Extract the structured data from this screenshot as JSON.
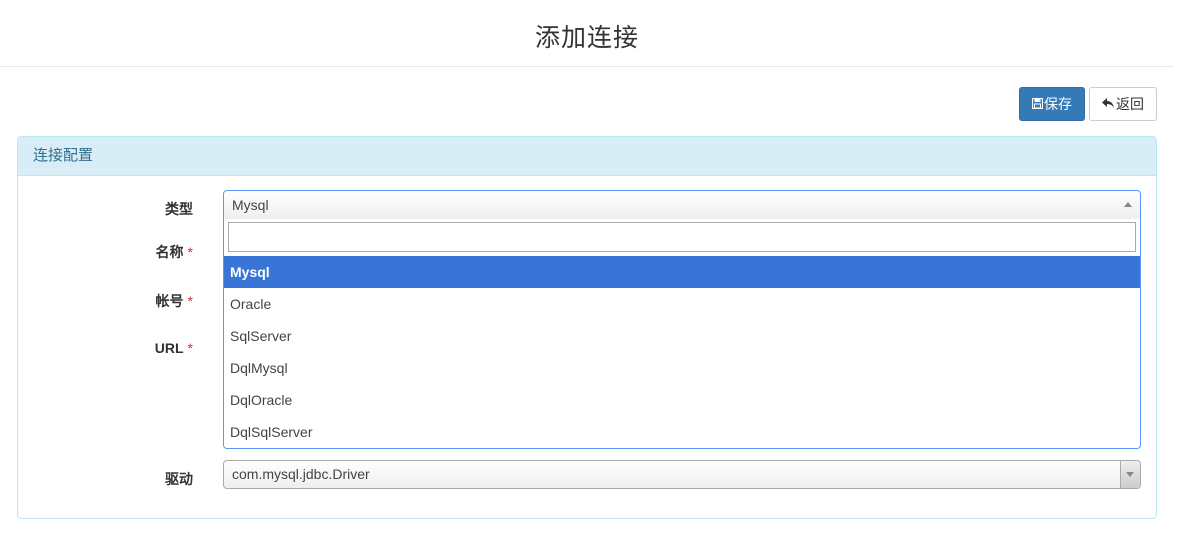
{
  "page": {
    "title": "添加连接"
  },
  "toolbar": {
    "save_label": "保存",
    "save_icon": "floppy-disk-icon",
    "back_label": "返回",
    "back_icon": "undo-arrow-icon",
    "save_color": "#337ab7"
  },
  "panel": {
    "heading": "连接配置",
    "heading_bg": "#d9edf7",
    "heading_color": "#31708f"
  },
  "form": {
    "type_label": "类型",
    "name_label": "名称",
    "account_label": "帐号",
    "url_label": "URL",
    "driver_label": "驱动",
    "required_mark": "*",
    "type_value": "Mysql",
    "type_search_value": "",
    "type_options": [
      "Mysql",
      "Oracle",
      "SqlServer",
      "DqlMysql",
      "DqlOracle",
      "DqlSqlServer"
    ],
    "type_highlighted": "Mysql",
    "highlight_color": "#3875d7",
    "driver_value": "com.mysql.jdbc.Driver"
  }
}
